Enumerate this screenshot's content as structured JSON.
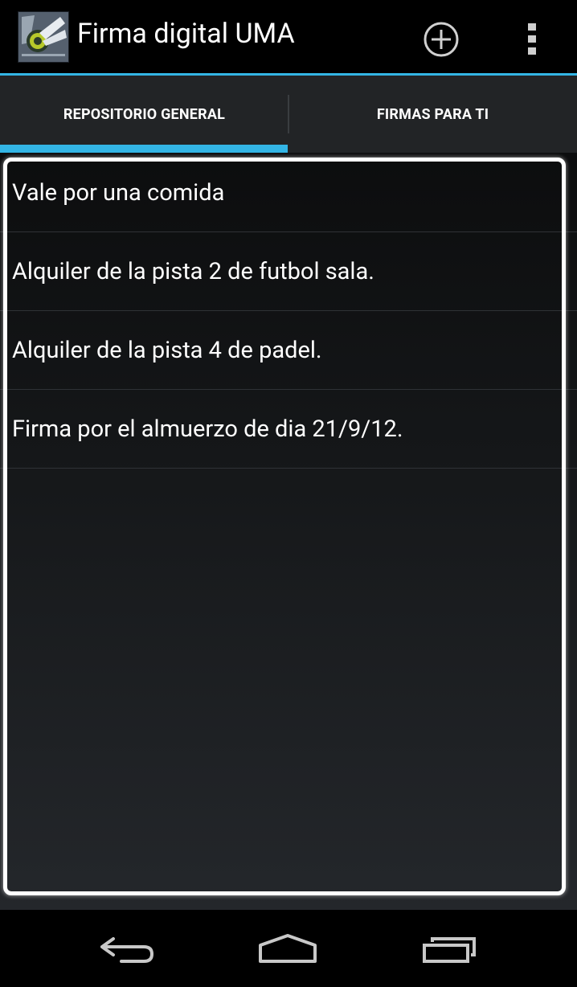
{
  "action_bar": {
    "logo_icon": "uma-university-logo",
    "title": "Firma digital UMA",
    "add_icon": "add-circle-icon",
    "overflow_icon": "overflow-menu-icon"
  },
  "tabs": [
    {
      "label": "REPOSITORIO GENERAL",
      "selected": true
    },
    {
      "label": "FIRMAS PARA TI",
      "selected": false
    }
  ],
  "list": {
    "items": [
      {
        "label": "Vale por una comida"
      },
      {
        "label": "Alquiler de la pista 2 de futbol sala."
      },
      {
        "label": "Alquiler de la pista 4 de padel."
      },
      {
        "label": "Firma por el almuerzo de dia 21/9/12."
      }
    ]
  },
  "nav_bar": {
    "back_icon": "back-icon",
    "home_icon": "home-icon",
    "recents_icon": "recent-apps-icon"
  },
  "colors": {
    "accent": "#33b5e5",
    "action_bar_bg": "#000000",
    "tab_bar_bg": "#222426"
  }
}
